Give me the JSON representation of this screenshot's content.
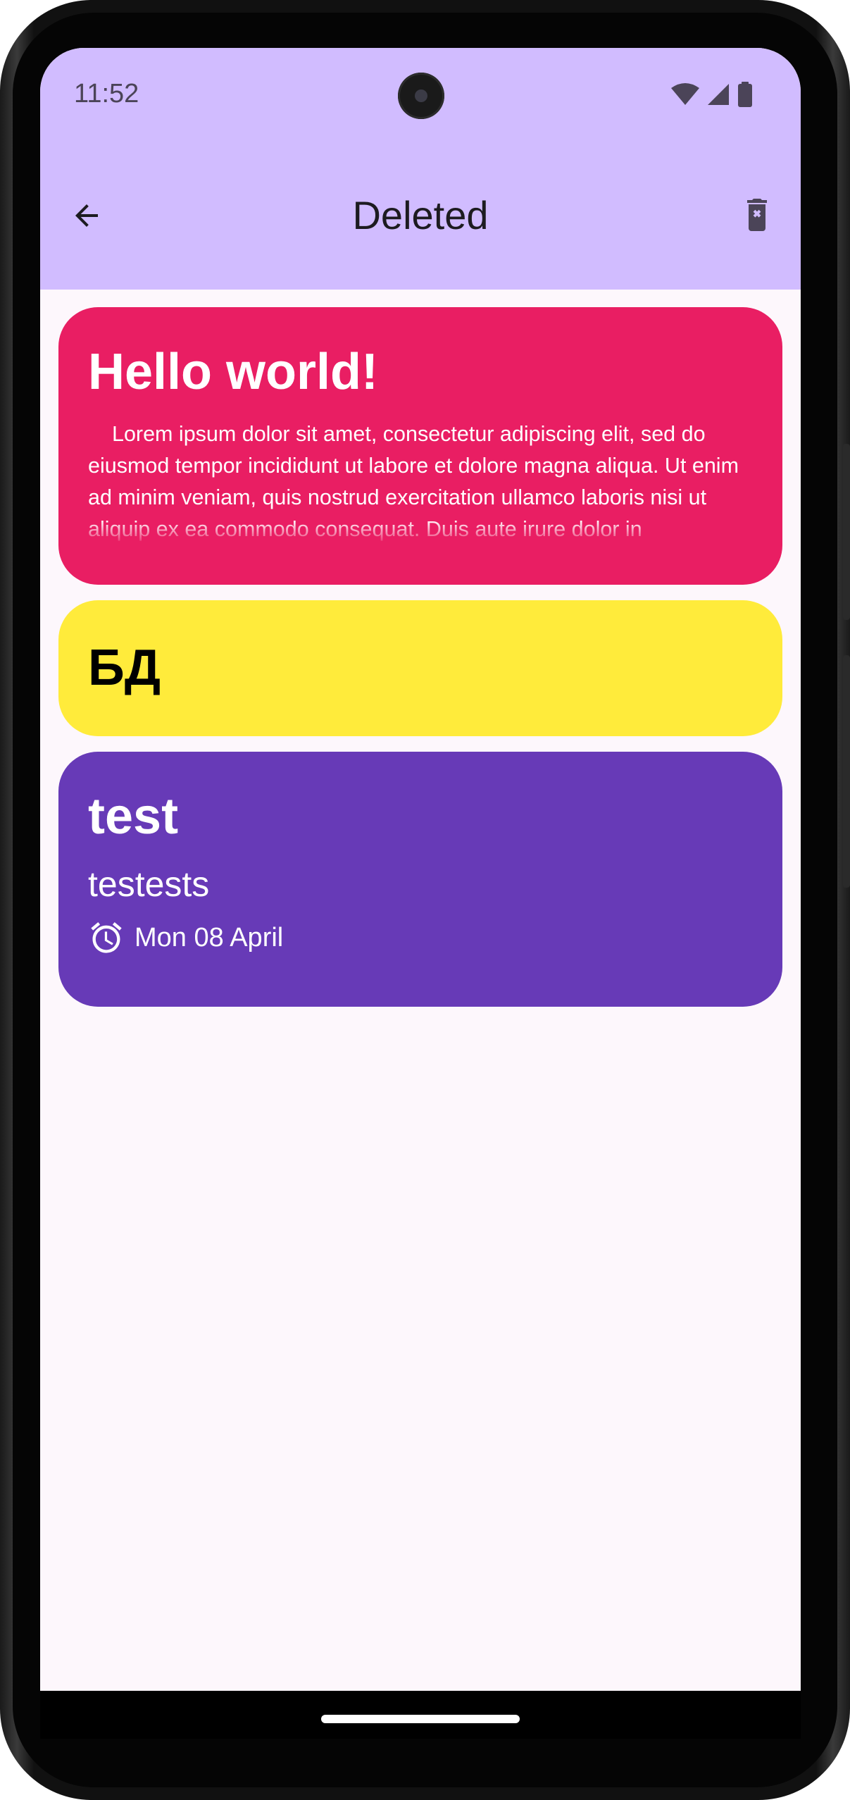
{
  "status_bar": {
    "time": "11:52",
    "icons": [
      "wifi-icon",
      "cellular-signal-icon",
      "battery-icon"
    ]
  },
  "app_bar": {
    "title": "Deleted",
    "back_icon": "arrow-back-icon",
    "action_icon": "delete-forever-icon",
    "background": "#d1bcff"
  },
  "notes": [
    {
      "title": "Hello world!",
      "body": "Lorem ipsum dolor sit amet, consectetur adipiscing elit, sed do eiusmod tempor incididunt ut labore et dolore magna aliqua. Ut enim ad minim veniam, quis nostrud exercitation ullamco laboris nisi ut aliquip ex ea commodo consequat. Duis aute irure dolor in reprehenderit in voluptate velit esse cillum dolore eu fugiat nulla pariatur.",
      "color": "#e91e63"
    },
    {
      "title": "БД",
      "color": "#ffeb3b"
    },
    {
      "title": "test",
      "subtitle": "testests",
      "reminder": "Mon 08 April",
      "reminder_icon": "alarm-icon",
      "color": "#673ab7"
    }
  ],
  "colors": {
    "background": "#fdf7fc",
    "status_text": "#4b4458"
  }
}
